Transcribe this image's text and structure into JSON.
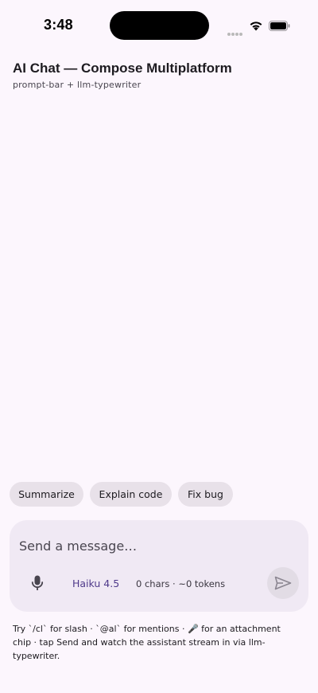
{
  "status_bar": {
    "time": "3:48",
    "icons": [
      "cellular-signal-icon",
      "wifi-icon",
      "battery-icon"
    ]
  },
  "header": {
    "title": "AI Chat — Compose Multiplatform",
    "subtitle": "prompt-bar + llm-typewriter"
  },
  "suggestions": [
    {
      "label": "Summarize"
    },
    {
      "label": "Explain code"
    },
    {
      "label": "Fix bug"
    }
  ],
  "composer": {
    "placeholder": "Send a message…",
    "mic_icon": "mic-icon",
    "model": "Haiku 4.5",
    "counter": "0 chars · ~0 tokens",
    "send_icon": "send-icon"
  },
  "help": {
    "text": "Try `/cl` for slash · `@al` for mentions · 🎤 for an attachment chip · tap Send and watch the assistant stream in via llm-typewriter."
  },
  "colors": {
    "background": "#FCF6FD",
    "chip_background": "#E8E1E9",
    "composer_background": "#F0E9F4",
    "model_accent": "#4F3A8A",
    "send_button_disabled": "#E2DCE5"
  }
}
